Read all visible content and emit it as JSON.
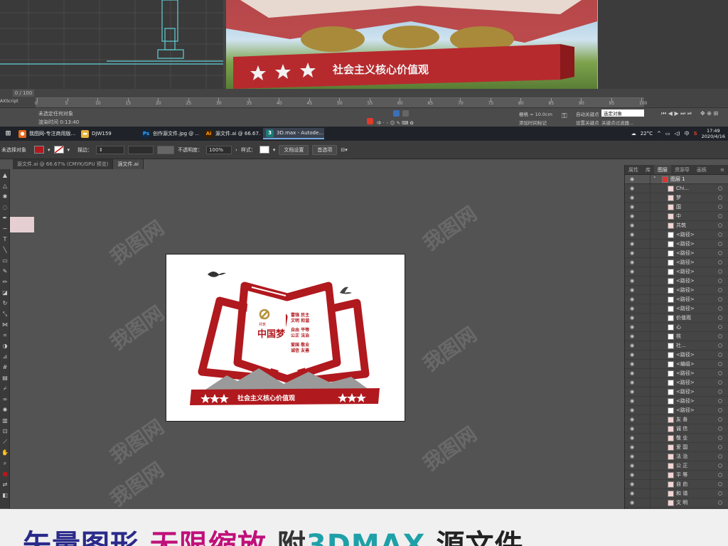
{
  "max": {
    "frame_counter": "0 / 100",
    "timeline_ticks": [
      "0",
      "5",
      "10",
      "15",
      "20",
      "25",
      "30",
      "35",
      "40",
      "45",
      "50",
      "55",
      "60",
      "65",
      "70",
      "75",
      "80",
      "85",
      "90",
      "95",
      "100"
    ],
    "script_label": "AXScript",
    "status_line1": "未选定任何对象",
    "status_line2": "渲染时间 0:13:40",
    "grid_label": "栅格 = 10.0cm",
    "add_time_tag": "添加时间标记",
    "auto_key": "自动关键点",
    "set_key": "设置关键点",
    "selected_object": "选定对象",
    "key_filter": "关键点过滤器...",
    "viewport_sign_text": "社会主义核心价值观"
  },
  "taskbar": {
    "apps": [
      {
        "label": "我图网-专注商用版...",
        "icon": "browser-icon",
        "color": "#e8671c"
      },
      {
        "label": "DJW159",
        "icon": "folder-icon",
        "color": "#e6b43c"
      },
      {
        "label": "创作源文件.jpg @ ...",
        "icon": "photoshop-icon",
        "color": "#0f2a4a"
      },
      {
        "label": "源文件.ai @ 66.67...",
        "icon": "illustrator-icon",
        "color": "#3a1d00"
      },
      {
        "label": "3D.max - Autode...",
        "icon": "3dsmax-icon",
        "color": "#1a7a78"
      }
    ],
    "temperature": "22°C",
    "lang": "中",
    "time": "17:49",
    "date": "2020/4/16"
  },
  "control_bar": {
    "selection_label": "未选择对象",
    "stroke_label": "描边：",
    "opacity_label": "不透明度：",
    "opacity_value": "100%",
    "style_label": "样式：",
    "doc_setup": "文档设置",
    "preferences": "首选项"
  },
  "doc_tabs": [
    "源文件.ai @ 66.67% (CMYK/GPU 预览)",
    "源文件.ai"
  ],
  "panel": {
    "tabs": [
      "属性",
      "库",
      "图层",
      "资源导",
      "画板"
    ],
    "active_tab": "图层",
    "layer_name": "图层 1",
    "items": [
      "Chi...",
      "梦",
      "国",
      "中",
      "共筑",
      "<路径>",
      "<路径>",
      "<路径>",
      "<路径>",
      "<路径>",
      "<路径>",
      "<路径>",
      "<路径>",
      "<路径>",
      "价值观",
      "心",
      "核",
      "社...",
      "<路径>",
      "<编组>",
      "<路径>",
      "<路径>",
      "<路径>",
      "<路径>",
      "<路径>",
      "友 善",
      "诚 信",
      "敬 业",
      "爱 国",
      "法 治",
      "公 正",
      "平 等",
      "自 由",
      "和 谐",
      "文 明",
      "民 主"
    ]
  },
  "artboard": {
    "values_text": [
      "富强 民主",
      "文明 和谐",
      "自由 平等",
      "公正 法治",
      "爱国 敬业",
      "诚信 友善"
    ],
    "dream_small": "共筑",
    "dream_big": "中国梦",
    "ribbon_text": "社会主义核心价值观",
    "colors": {
      "red": "#b0191e",
      "dark_red": "#8a1116",
      "gold": "#b58f3a",
      "mountain": "#9a9a9a"
    }
  },
  "watermark": "我图网",
  "banner": {
    "part1": "矢量图形",
    "part2": "无限缩放",
    "part3": "附",
    "part4": "3DMAX",
    "part5": "源文件"
  }
}
